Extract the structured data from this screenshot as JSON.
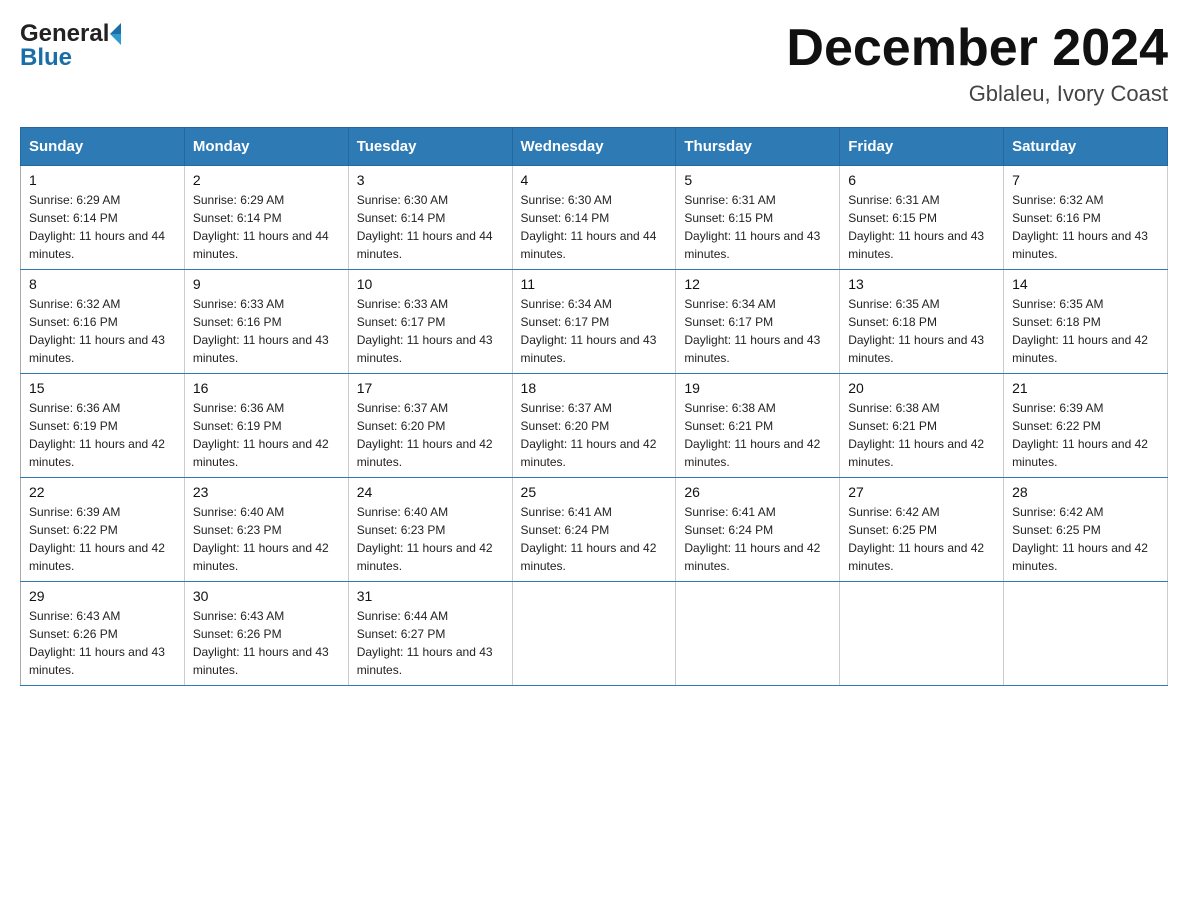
{
  "header": {
    "logo_general": "General",
    "logo_blue": "Blue",
    "month_title": "December 2024",
    "location": "Gblaleu, Ivory Coast"
  },
  "calendar": {
    "days_of_week": [
      "Sunday",
      "Monday",
      "Tuesday",
      "Wednesday",
      "Thursday",
      "Friday",
      "Saturday"
    ],
    "weeks": [
      [
        {
          "day": "1",
          "sunrise": "6:29 AM",
          "sunset": "6:14 PM",
          "daylight": "11 hours and 44 minutes."
        },
        {
          "day": "2",
          "sunrise": "6:29 AM",
          "sunset": "6:14 PM",
          "daylight": "11 hours and 44 minutes."
        },
        {
          "day": "3",
          "sunrise": "6:30 AM",
          "sunset": "6:14 PM",
          "daylight": "11 hours and 44 minutes."
        },
        {
          "day": "4",
          "sunrise": "6:30 AM",
          "sunset": "6:14 PM",
          "daylight": "11 hours and 44 minutes."
        },
        {
          "day": "5",
          "sunrise": "6:31 AM",
          "sunset": "6:15 PM",
          "daylight": "11 hours and 43 minutes."
        },
        {
          "day": "6",
          "sunrise": "6:31 AM",
          "sunset": "6:15 PM",
          "daylight": "11 hours and 43 minutes."
        },
        {
          "day": "7",
          "sunrise": "6:32 AM",
          "sunset": "6:16 PM",
          "daylight": "11 hours and 43 minutes."
        }
      ],
      [
        {
          "day": "8",
          "sunrise": "6:32 AM",
          "sunset": "6:16 PM",
          "daylight": "11 hours and 43 minutes."
        },
        {
          "day": "9",
          "sunrise": "6:33 AM",
          "sunset": "6:16 PM",
          "daylight": "11 hours and 43 minutes."
        },
        {
          "day": "10",
          "sunrise": "6:33 AM",
          "sunset": "6:17 PM",
          "daylight": "11 hours and 43 minutes."
        },
        {
          "day": "11",
          "sunrise": "6:34 AM",
          "sunset": "6:17 PM",
          "daylight": "11 hours and 43 minutes."
        },
        {
          "day": "12",
          "sunrise": "6:34 AM",
          "sunset": "6:17 PM",
          "daylight": "11 hours and 43 minutes."
        },
        {
          "day": "13",
          "sunrise": "6:35 AM",
          "sunset": "6:18 PM",
          "daylight": "11 hours and 43 minutes."
        },
        {
          "day": "14",
          "sunrise": "6:35 AM",
          "sunset": "6:18 PM",
          "daylight": "11 hours and 42 minutes."
        }
      ],
      [
        {
          "day": "15",
          "sunrise": "6:36 AM",
          "sunset": "6:19 PM",
          "daylight": "11 hours and 42 minutes."
        },
        {
          "day": "16",
          "sunrise": "6:36 AM",
          "sunset": "6:19 PM",
          "daylight": "11 hours and 42 minutes."
        },
        {
          "day": "17",
          "sunrise": "6:37 AM",
          "sunset": "6:20 PM",
          "daylight": "11 hours and 42 minutes."
        },
        {
          "day": "18",
          "sunrise": "6:37 AM",
          "sunset": "6:20 PM",
          "daylight": "11 hours and 42 minutes."
        },
        {
          "day": "19",
          "sunrise": "6:38 AM",
          "sunset": "6:21 PM",
          "daylight": "11 hours and 42 minutes."
        },
        {
          "day": "20",
          "sunrise": "6:38 AM",
          "sunset": "6:21 PM",
          "daylight": "11 hours and 42 minutes."
        },
        {
          "day": "21",
          "sunrise": "6:39 AM",
          "sunset": "6:22 PM",
          "daylight": "11 hours and 42 minutes."
        }
      ],
      [
        {
          "day": "22",
          "sunrise": "6:39 AM",
          "sunset": "6:22 PM",
          "daylight": "11 hours and 42 minutes."
        },
        {
          "day": "23",
          "sunrise": "6:40 AM",
          "sunset": "6:23 PM",
          "daylight": "11 hours and 42 minutes."
        },
        {
          "day": "24",
          "sunrise": "6:40 AM",
          "sunset": "6:23 PM",
          "daylight": "11 hours and 42 minutes."
        },
        {
          "day": "25",
          "sunrise": "6:41 AM",
          "sunset": "6:24 PM",
          "daylight": "11 hours and 42 minutes."
        },
        {
          "day": "26",
          "sunrise": "6:41 AM",
          "sunset": "6:24 PM",
          "daylight": "11 hours and 42 minutes."
        },
        {
          "day": "27",
          "sunrise": "6:42 AM",
          "sunset": "6:25 PM",
          "daylight": "11 hours and 42 minutes."
        },
        {
          "day": "28",
          "sunrise": "6:42 AM",
          "sunset": "6:25 PM",
          "daylight": "11 hours and 42 minutes."
        }
      ],
      [
        {
          "day": "29",
          "sunrise": "6:43 AM",
          "sunset": "6:26 PM",
          "daylight": "11 hours and 43 minutes."
        },
        {
          "day": "30",
          "sunrise": "6:43 AM",
          "sunset": "6:26 PM",
          "daylight": "11 hours and 43 minutes."
        },
        {
          "day": "31",
          "sunrise": "6:44 AM",
          "sunset": "6:27 PM",
          "daylight": "11 hours and 43 minutes."
        },
        null,
        null,
        null,
        null
      ]
    ]
  }
}
